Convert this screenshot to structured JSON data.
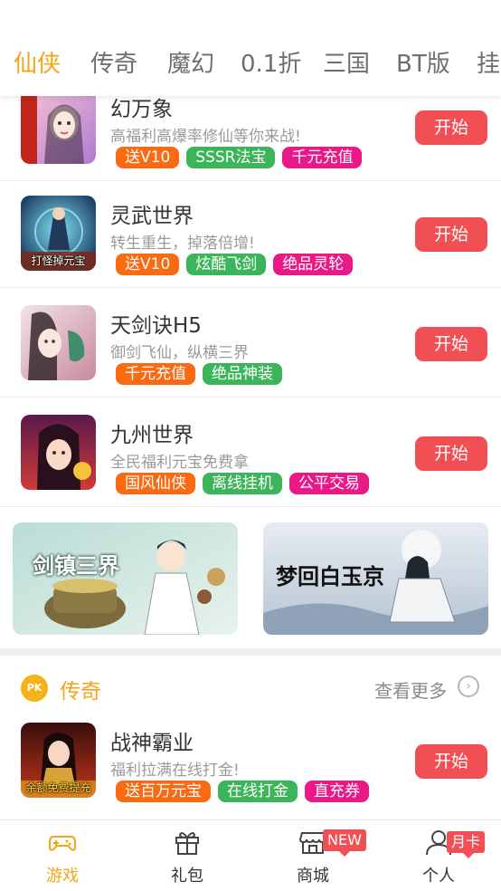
{
  "tabs": [
    "仙侠",
    "传奇",
    "魔幻",
    "0.1折",
    "三国",
    "BT版",
    "挂"
  ],
  "games": [
    {
      "name": "幻万象",
      "desc": "高福利高爆率修仙等你来战!",
      "tags": [
        "送V10",
        "SSSR法宝",
        "千元充值"
      ],
      "tag_colors": [
        "#f96a12",
        "#3cb55a",
        "#ea1987"
      ],
      "thumb_caption": "",
      "button": "开始"
    },
    {
      "name": "灵武世界",
      "desc": "转生重生，掉落倍增!",
      "tags": [
        "送V10",
        "炫酷飞剑",
        "绝品灵轮"
      ],
      "tag_colors": [
        "#f96a12",
        "#3cb55a",
        "#ea1987"
      ],
      "thumb_caption": "打怪掉元宝",
      "button": "开始"
    },
    {
      "name": "天剑诀H5",
      "desc": "御剑飞仙，纵横三界",
      "tags": [
        "千元充值",
        "绝品神装"
      ],
      "tag_colors": [
        "#f96a12",
        "#3cb55a"
      ],
      "thumb_caption": "",
      "button": "开始"
    },
    {
      "name": "九州世界",
      "desc": "全民福利元宝免费拿",
      "tags": [
        "国风仙侠",
        "离线挂机",
        "公平交易"
      ],
      "tag_colors": [
        "#f96a12",
        "#3cb55a",
        "#ea1987"
      ],
      "thumb_caption": "",
      "button": "开始"
    }
  ],
  "banners": [
    {
      "title": "剑镇三界"
    },
    {
      "title": "梦回白玉京"
    }
  ],
  "section": {
    "badge": "PK",
    "title": "传奇",
    "more": "查看更多"
  },
  "section_games": [
    {
      "name": "战神霸业",
      "desc": "福利拉满在线打金!",
      "tags": [
        "送百万元宝",
        "在线打金",
        "直充券"
      ],
      "tag_colors": [
        "#f96a12",
        "#3cb55a",
        "#ea1987"
      ],
      "thumb_caption": "余额免费提充",
      "button": "开始"
    }
  ],
  "bottom_nav": [
    {
      "label": "游戏",
      "icon": "gamepad-icon",
      "active": true
    },
    {
      "label": "礼包",
      "icon": "gift-icon",
      "active": false
    },
    {
      "label": "商城",
      "icon": "store-icon",
      "active": false,
      "badge": "NEW"
    },
    {
      "label": "个人",
      "icon": "user-icon",
      "active": false,
      "badge": "月卡"
    }
  ],
  "colors": {
    "accent": "#f4a417",
    "button": "#f24f55",
    "tag_orange": "#f96a12",
    "tag_green": "#3cb55a",
    "tag_pink": "#ea1987"
  }
}
